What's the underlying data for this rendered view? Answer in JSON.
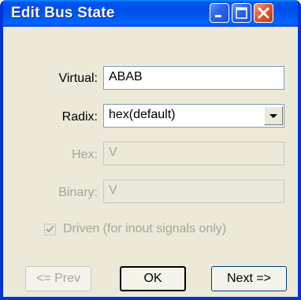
{
  "window": {
    "title": "Edit Bus State"
  },
  "titlebar_buttons": {
    "minimize_icon": "minimize-icon",
    "maximize_icon": "maximize-icon",
    "close_icon": "close-icon"
  },
  "form": {
    "virtual": {
      "label": "Virtual:",
      "value": "ABAB"
    },
    "radix": {
      "label": "Radix:",
      "value": "hex(default)"
    },
    "hex": {
      "label": "Hex:",
      "value": "V"
    },
    "binary": {
      "label": "Binary:",
      "value": "V"
    },
    "driven": {
      "label": "Driven (for inout signals only)",
      "checked": true
    }
  },
  "buttons": {
    "prev": "<= Prev",
    "ok": "OK",
    "next": "Next =>"
  },
  "colors": {
    "titlebar": "#0054E3",
    "dialog_bg": "#ECE9D8",
    "disabled_text": "#A7A695"
  }
}
